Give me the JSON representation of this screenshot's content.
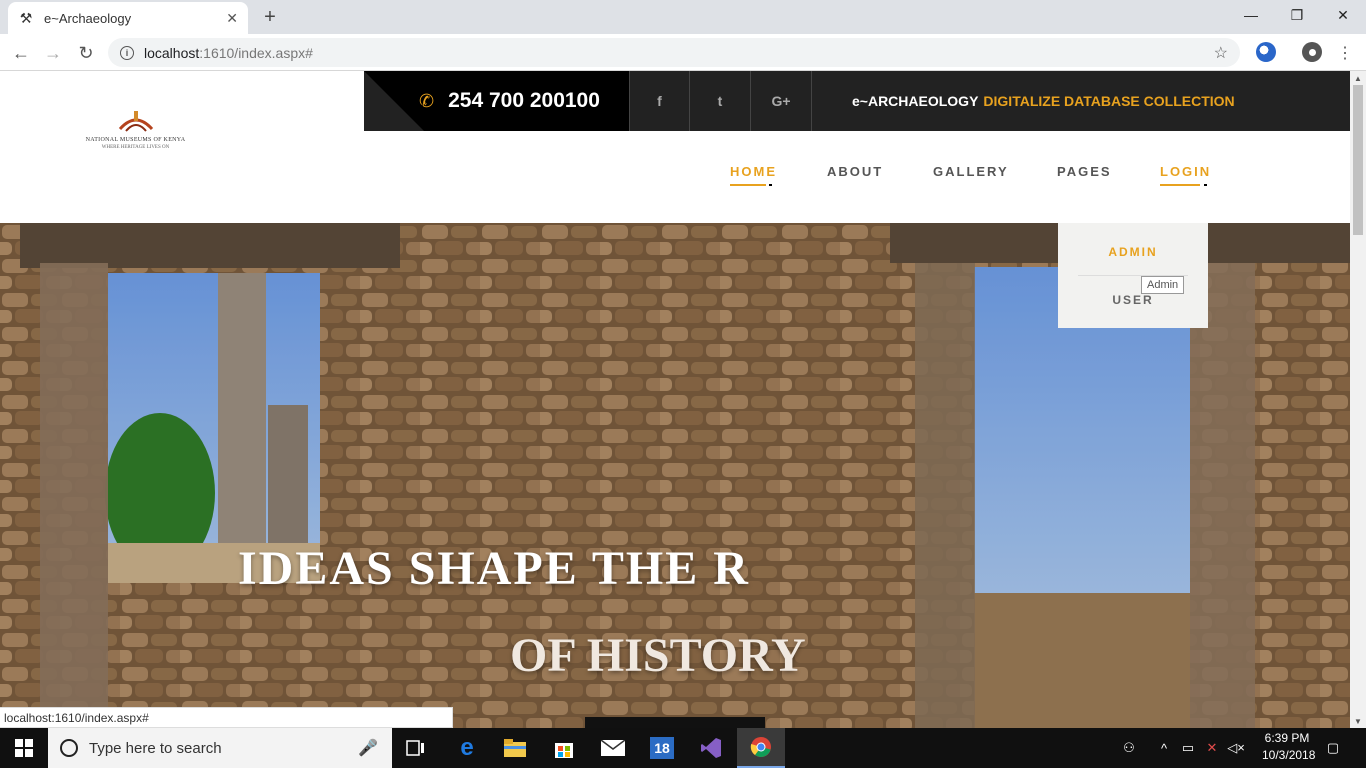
{
  "browser": {
    "tab_title": "e~Archaeology",
    "tab_close": "✕",
    "new_tab": "+",
    "url_host": "localhost",
    "url_path": ":1610/index.aspx#",
    "win_min": "—",
    "win_restore": "❐",
    "win_close": "✕"
  },
  "site": {
    "logo_name": "NATIONAL MUSEUMS OF KENYA",
    "logo_tagline": "WHERE HERITAGE LIVES ON",
    "phone": "254 700 200100",
    "social": [
      "f",
      "t",
      "G+"
    ],
    "tagline_a": "e~ARCHAEOLOGY",
    "tagline_b": "DIGITALIZE DATABASE COLLECTION",
    "nav": [
      "HOME",
      "ABOUT",
      "GALLERY",
      "PAGES",
      "LOGIN"
    ],
    "dropdown": [
      "ADMIN",
      "USER"
    ],
    "tooltip": "Admin",
    "hero_line1": "IDEAS SHAPE THE R",
    "hero_line2": "OF HISTORY",
    "status_url": "localhost:1610/index.aspx#"
  },
  "taskbar": {
    "search_placeholder": "Type here to search",
    "calendar_badge": "18",
    "time": "6:39 PM",
    "date": "10/3/2018"
  },
  "colors": {
    "accent": "#e8a21f",
    "topbar": "#222222"
  }
}
